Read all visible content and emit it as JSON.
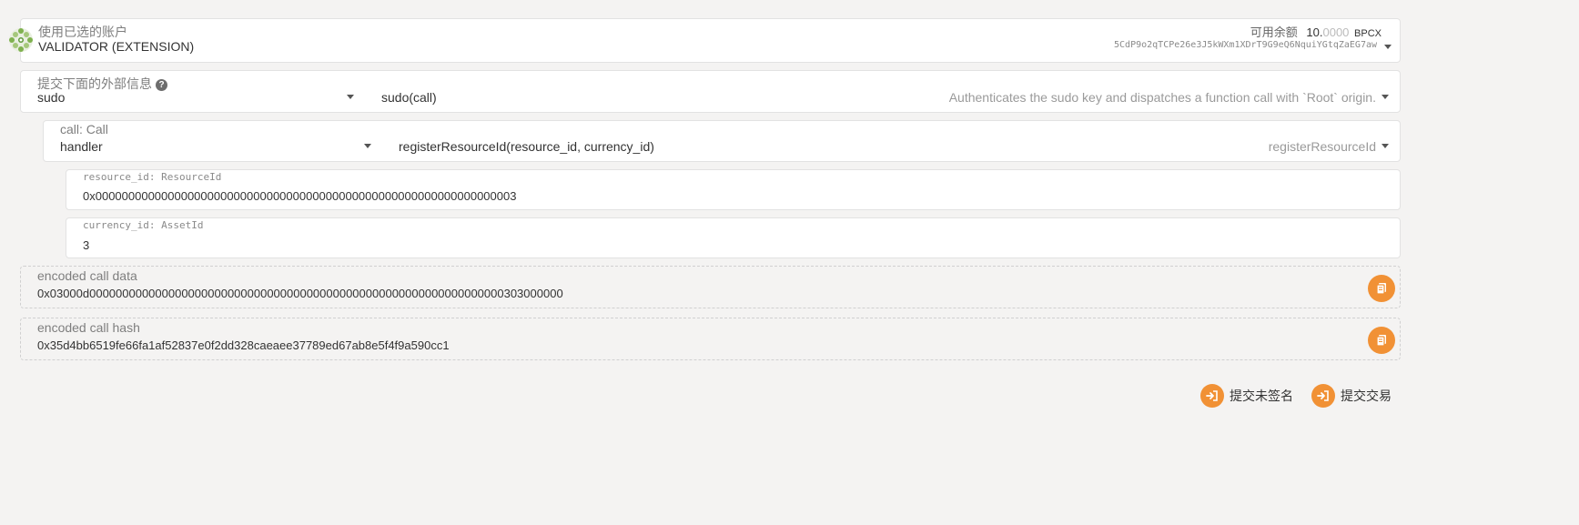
{
  "account": {
    "label": "使用已选的账户",
    "name": "VALIDATOR (EXTENSION)",
    "balance_label": "可用余额",
    "balance_int": "10.",
    "balance_dec": "0000",
    "balance_unit": "BPCX",
    "address": "5CdP9o2qTCPe26e3J5kWXm1XDrT9G9eQ6NquiYGtqZaEG7aw"
  },
  "extrinsic": {
    "label": "提交下面的外部信息",
    "help_icon": "?",
    "section": "sudo",
    "method": "sudo(call)",
    "description": "Authenticates the sudo key and dispatches a function call with `Root` origin."
  },
  "call": {
    "label": "call: Call",
    "section": "handler",
    "method": "registerResourceId(resource_id, currency_id)",
    "description": "registerResourceId"
  },
  "params": [
    {
      "label": "resource_id: ResourceId",
      "value": "0x0000000000000000000000000000000000000000000000000000000000000003"
    },
    {
      "label": "currency_id: AssetId",
      "value": "3"
    }
  ],
  "encoded": {
    "data_label": "encoded call data",
    "data_value": "0x03000d000000000000000000000000000000000000000000000000000000000000000303000000",
    "hash_label": "encoded call hash",
    "hash_value": "0x35d4bb6519fe66fa1af52837e0f2dd328caeaee37789ed67ab8e5f4f9a590cc1"
  },
  "actions": {
    "unsigned_label": "提交未签名",
    "sign_label": "提交交易"
  },
  "colors": {
    "accent": "#f19135",
    "background": "#f4f3f2"
  }
}
